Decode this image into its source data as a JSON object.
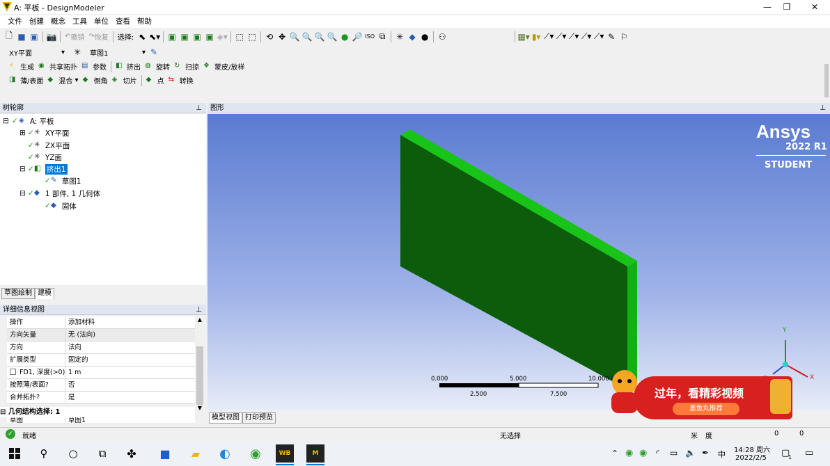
{
  "window": {
    "title": "A: 平板 - DesignModeler"
  },
  "menu": [
    "文件",
    "创建",
    "概念",
    "工具",
    "单位",
    "查看",
    "帮助"
  ],
  "toolbar1": {
    "undo": "撤销",
    "redo": "恢复",
    "select": "选择:"
  },
  "toolbar2": {
    "plane": "XY平面",
    "sketch": "草图1"
  },
  "toolbar3": [
    "生成",
    "共享拓扑",
    "参数",
    "挤出",
    "旋转",
    "扫掠",
    "蒙皮/放样"
  ],
  "toolbar4": [
    "薄/表面",
    "混合",
    "倒角",
    "切片",
    "点",
    "转换"
  ],
  "tree": {
    "header": "树轮廓",
    "pin": "♯",
    "nodes": [
      "A: 平板",
      "XY平面",
      "ZX平面",
      "YZ面",
      "挤出1",
      "草图1",
      "1 部件, 1 几何体",
      "固体"
    ]
  },
  "left_tabs": [
    "草图绘制",
    "建模"
  ],
  "details": {
    "header": "详细信息视图",
    "rows": [
      {
        "k": "操作",
        "v": "添加材料"
      },
      {
        "k": "方向矢量",
        "v": "无 (法向)"
      },
      {
        "k": "方向",
        "v": "法向"
      },
      {
        "k": "扩展类型",
        "v": "固定的"
      },
      {
        "k": "FD1, 深度(>0)",
        "v": "1 m"
      },
      {
        "k": "按照薄/表面?",
        "v": "否"
      },
      {
        "k": "合并拓扑?",
        "v": "是"
      }
    ],
    "section": "几何结构选择: 1",
    "last_row": {
      "k": "草图",
      "v": "草图1"
    }
  },
  "graphics": {
    "header": "图形",
    "logo": "Ansys",
    "version": "2022 R1",
    "edition": "STUDENT",
    "scale": {
      "top": [
        "0.000",
        "5.000",
        "10.000 (m)"
      ],
      "bottom": [
        "2.500",
        "7.500"
      ]
    },
    "axes": {
      "x": "X",
      "y": "Y",
      "z": "Z"
    },
    "tabs": [
      "模型视图",
      "打印预览"
    ],
    "ad": {
      "headline": "过年，看精彩视频",
      "button": "墨鱼丸推荐"
    }
  },
  "status": {
    "ready": "就绪",
    "selection": "无选择",
    "unit": "米",
    "angle": "度",
    "v1": "0",
    "v2": "0"
  },
  "taskbar": {
    "time": "14:28 周六",
    "date": "2022/2/5",
    "ime": "中",
    "badge": "1"
  },
  "colors": {
    "body_front": "#0b5e0b",
    "body_edge": "#17c017",
    "accent": "#0078d7"
  }
}
